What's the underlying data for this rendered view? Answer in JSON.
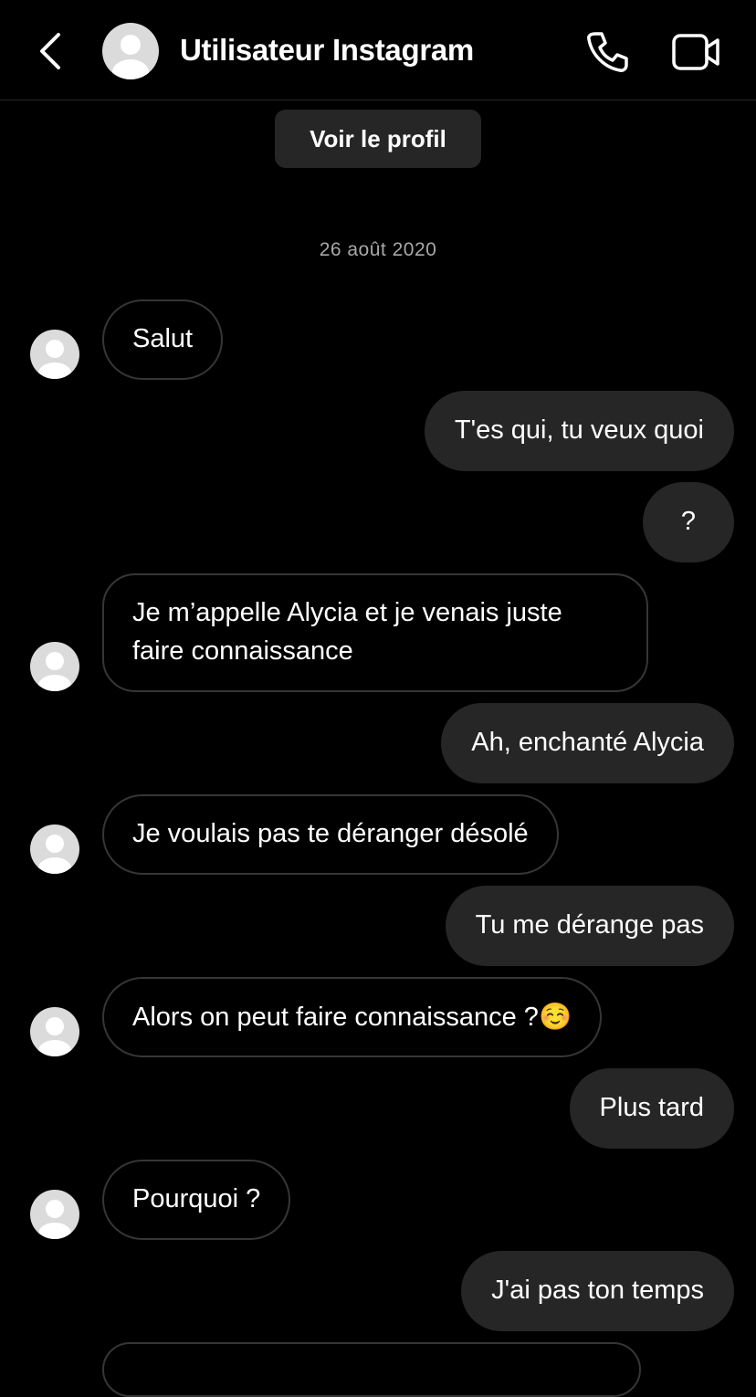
{
  "header": {
    "title": "Utilisateur Instagram",
    "icons": [
      "back-arrow-icon",
      "avatar-placeholder-icon",
      "phone-icon",
      "video-camera-icon"
    ]
  },
  "profile_button_label": "Voir le profil",
  "date_separator": "26 août 2020",
  "messages": [
    {
      "side": "incoming",
      "text": "Salut"
    },
    {
      "side": "outgoing",
      "text": "T'es qui, tu veux quoi"
    },
    {
      "side": "outgoing",
      "text": "?"
    },
    {
      "side": "incoming",
      "text": "Je m’appelle Alycia et je venais juste faire connaissance"
    },
    {
      "side": "outgoing",
      "text": "Ah, enchanté Alycia"
    },
    {
      "side": "incoming",
      "text": "Je voulais pas te déranger désolé"
    },
    {
      "side": "outgoing",
      "text": "Tu me dérange pas"
    },
    {
      "side": "incoming",
      "text": "Alors on peut faire connaissance ?",
      "emoji": "☺️"
    },
    {
      "side": "outgoing",
      "text": "Plus tard"
    },
    {
      "side": "incoming",
      "text": "Pourquoi ?"
    },
    {
      "side": "outgoing",
      "text": "J'ai pas ton temps"
    }
  ],
  "colors": {
    "background": "#000000",
    "outgoing_bubble": "#262626",
    "incoming_border": "#363636",
    "date_text": "#a8a8a8",
    "avatar_placeholder": "#dbdbdb"
  }
}
